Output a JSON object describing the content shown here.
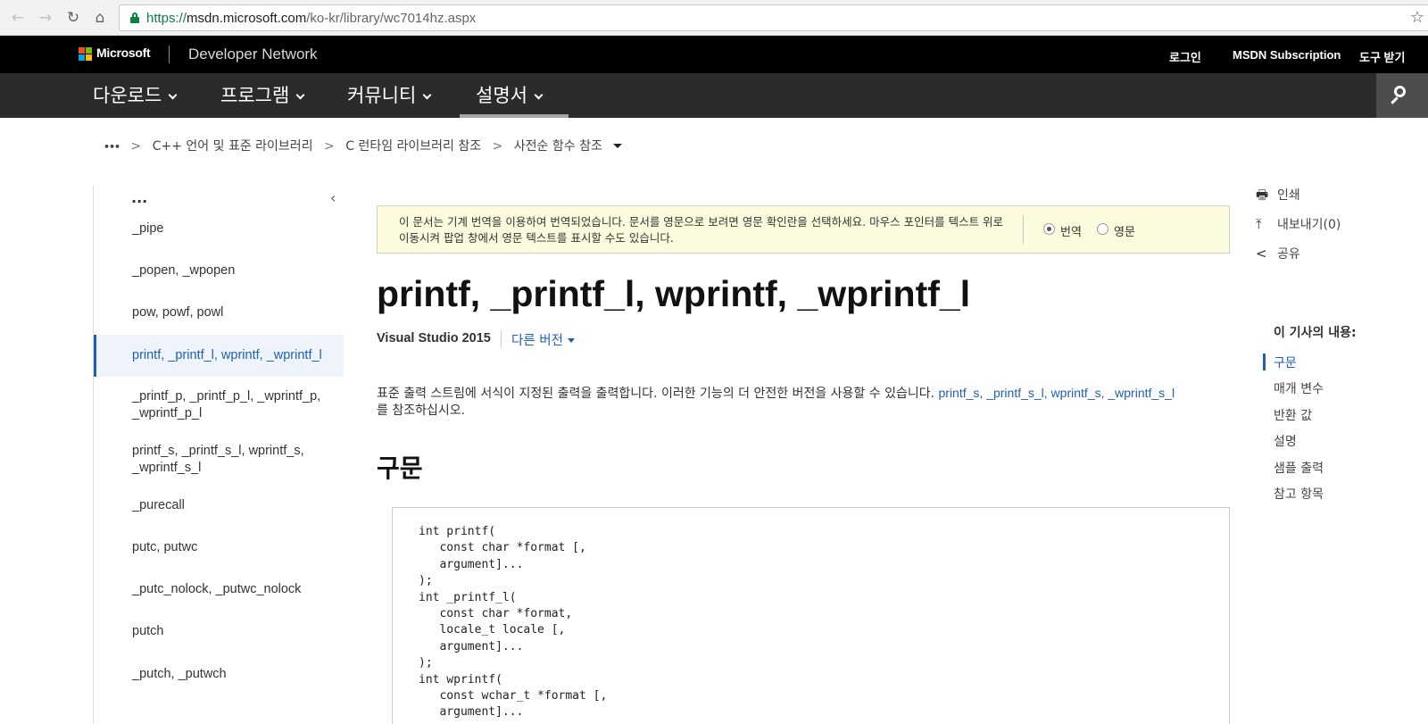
{
  "browser": {
    "url_scheme": "https://",
    "url_host": "msdn.microsoft.com",
    "url_path": "/ko-kr/library/wc7014hz.aspx"
  },
  "header": {
    "brand": "Microsoft",
    "site": "Developer Network",
    "links": [
      "로그인",
      "MSDN Subscription",
      "도구 받기"
    ]
  },
  "nav": {
    "items": [
      "다운로드",
      "프로그램",
      "커뮤니티",
      "설명서"
    ],
    "active": "설명서"
  },
  "breadcrumb": {
    "more": "•••",
    "items": [
      "C++ 언어 및 표준 라이브러리",
      "C 런타임 라이브러리 참조",
      "사전순 함수 참조"
    ]
  },
  "toc": {
    "more": "...",
    "collapse": "‹",
    "items": [
      "_pipe",
      "_popen, _wpopen",
      "pow, powf, powl",
      "printf, _printf_l, wprintf, _wprintf_l",
      "_printf_p, _printf_p_l, _wprintf_p, _wprintf_p_l",
      "printf_s, _printf_s_l, wprintf_s, _wprintf_s_l",
      "_purecall",
      "putc, putwc",
      "_putc_nolock, _putwc_nolock",
      "putch",
      "_putch, _putwch"
    ]
  },
  "notice": {
    "text": "이 문서는 기계 번역을 이용하여 번역되었습니다. 문서를 영문으로 보려면 영문 확인란을 선택하세요. 마우스 포인터를 텍스트 위로 이동시켜 팝업 창에서 영문 텍스트를 표시할 수도 있습니다.",
    "option_translated": "번역",
    "option_english": "영문"
  },
  "article": {
    "title": "printf, _printf_l, wprintf, _wprintf_l",
    "version": "Visual Studio 2015",
    "other_versions": "다른 버전",
    "desc_before": "표준 출력 스트림에 서식이 지정된 출력을 출력합니다. 이러한 기능의 더 안전한 버전을 사용할 수 있습니다. ",
    "desc_link": "printf_s, _printf_s_l, wprintf_s, _wprintf_s_l",
    "desc_after": "를 참조하십시오.",
    "section_syntax": "구문",
    "code": "int printf(\n   const char *format [,\n   argument]...\n);\nint _printf_l(\n   const char *format,\n   locale_t locale [,\n   argument]...\n);\nint wprintf(\n   const wchar_t *format [,\n   argument]..."
  },
  "rail": {
    "print": "인쇄",
    "export": "내보내기(0)",
    "share": "공유",
    "in_this_article": "이 기사의 내용:",
    "links": [
      "구문",
      "매개 변수",
      "반환 값",
      "설명",
      "샘플 출력",
      "참고 항목"
    ]
  },
  "colors": {
    "accent": "#1f5fb5",
    "notice_bg": "#fdfbdd",
    "nav_bg": "#2b2b2b",
    "header_bg": "#000000"
  }
}
